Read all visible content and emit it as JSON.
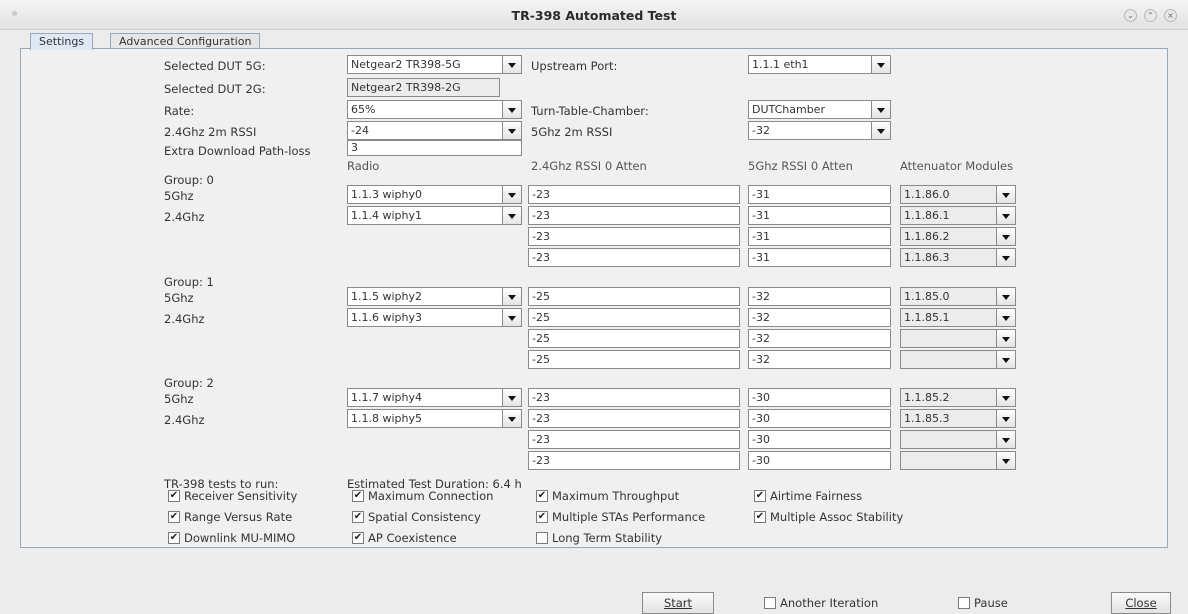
{
  "window": {
    "title": "TR-398 Automated Test"
  },
  "tabs": [
    {
      "label": "Settings",
      "active": true
    },
    {
      "label": "Advanced Configuration",
      "active": false
    }
  ],
  "settings": {
    "dut5g_label": "Selected DUT 5G:",
    "dut5g_value": "Netgear2 TR398-5G",
    "dut2g_label": "Selected DUT 2G:",
    "dut2g_value": "Netgear2 TR398-2G",
    "rate_label": "Rate:",
    "rate_value": "65%",
    "rssi24_label": "2.4Ghz 2m RSSI",
    "rssi24_value": "-24",
    "extra_label": "Extra Download Path-loss",
    "extra_value": "3",
    "upstream_label": "Upstream Port:",
    "upstream_value": "1.1.1 eth1",
    "turntable_label": "Turn-Table-Chamber:",
    "turntable_value": "DUTChamber",
    "rssi5_label": "5Ghz 2m RSSI",
    "rssi5_value": "-32"
  },
  "columns": {
    "radio": "Radio",
    "rssi24": "2.4Ghz RSSI 0 Atten",
    "rssi5": "5Ghz RSSI 0 Atten",
    "atten": "Attenuator Modules"
  },
  "groups": [
    {
      "label": "Group: 0",
      "band5_label": "5Ghz",
      "band24_label": "2.4Ghz",
      "radio5": "1.1.3 wiphy0",
      "radio24": "1.1.4 wiphy1",
      "rows": [
        {
          "rssi24": "-23",
          "rssi5": "-31",
          "atten": "1.1.86.0"
        },
        {
          "rssi24": "-23",
          "rssi5": "-31",
          "atten": "1.1.86.1"
        },
        {
          "rssi24": "-23",
          "rssi5": "-31",
          "atten": "1.1.86.2"
        },
        {
          "rssi24": "-23",
          "rssi5": "-31",
          "atten": "1.1.86.3"
        }
      ]
    },
    {
      "label": "Group: 1",
      "band5_label": "5Ghz",
      "band24_label": "2.4Ghz",
      "radio5": "1.1.5 wiphy2",
      "radio24": "1.1.6 wiphy3",
      "rows": [
        {
          "rssi24": "-25",
          "rssi5": "-32",
          "atten": "1.1.85.0"
        },
        {
          "rssi24": "-25",
          "rssi5": "-32",
          "atten": "1.1.85.1"
        },
        {
          "rssi24": "-25",
          "rssi5": "-32",
          "atten": ""
        },
        {
          "rssi24": "-25",
          "rssi5": "-32",
          "atten": ""
        }
      ]
    },
    {
      "label": "Group: 2",
      "band5_label": "5Ghz",
      "band24_label": "2.4Ghz",
      "radio5": "1.1.7 wiphy4",
      "radio24": "1.1.8 wiphy5",
      "rows": [
        {
          "rssi24": "-23",
          "rssi5": "-30",
          "atten": "1.1.85.2"
        },
        {
          "rssi24": "-23",
          "rssi5": "-30",
          "atten": "1.1.85.3"
        },
        {
          "rssi24": "-23",
          "rssi5": "-30",
          "atten": ""
        },
        {
          "rssi24": "-23",
          "rssi5": "-30",
          "atten": ""
        }
      ]
    }
  ],
  "tests": {
    "label": "TR-398 tests to run:",
    "duration": "Estimated Test Duration: 6.4 h",
    "items": [
      {
        "label": "Receiver Sensitivity",
        "checked": true
      },
      {
        "label": "Maximum Connection",
        "checked": true
      },
      {
        "label": "Maximum Throughput",
        "checked": true
      },
      {
        "label": "Airtime Fairness",
        "checked": true
      },
      {
        "label": "Range Versus Rate",
        "checked": true
      },
      {
        "label": "Spatial Consistency",
        "checked": true
      },
      {
        "label": "Multiple STAs Performance",
        "checked": true
      },
      {
        "label": "Multiple Assoc Stability",
        "checked": true
      },
      {
        "label": "Downlink MU-MIMO",
        "checked": true
      },
      {
        "label": "AP Coexistence",
        "checked": true
      },
      {
        "label": "Long Term Stability",
        "checked": false
      }
    ]
  },
  "footer": {
    "start_label": "Start",
    "another_label": "Another Iteration",
    "another_checked": false,
    "pause_label": "Pause",
    "pause_checked": false,
    "close_label": "Close"
  },
  "checkmark_glyph": "✔"
}
